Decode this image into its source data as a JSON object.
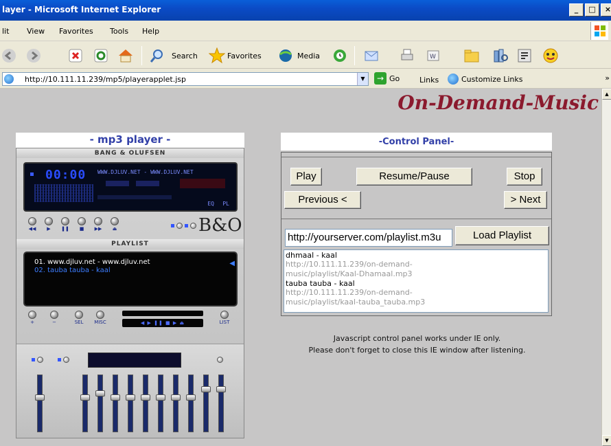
{
  "window": {
    "title": "layer - Microsoft Internet Explorer",
    "min": "_",
    "max": "□",
    "close": "×"
  },
  "menu": {
    "edit": "lit",
    "view": "View",
    "favorites": "Favorites",
    "tools": "Tools",
    "help": "Help"
  },
  "toolbar": {
    "search": "Search",
    "favorites": "Favorites",
    "media": "Media"
  },
  "address": {
    "url": "http://10.111.11.239/mp5/playerapplet.jsp",
    "go": "Go",
    "links": "Links",
    "customize_links": "Customize Links",
    "more": "»"
  },
  "brand": "On-Demand-Music",
  "player": {
    "title": "- mp3 player -",
    "maker": "BANG & OLUFSEN",
    "time": "00:00",
    "marquee": "WWW.DJLUV.NET - WWW.DJLUV.NET",
    "eq_label": "EQ",
    "pl_label": "PL",
    "bo_logo": "B&O",
    "playlist_header": "PLAYLIST",
    "playlist": [
      {
        "text": "01.  www.djluv.net - www.djluv.net",
        "color": "#ffffff"
      },
      {
        "text": "02.  tauba tauba - kaal",
        "color": "#3d7dff"
      }
    ],
    "sel_label": "SEL",
    "misc_label": "MISC",
    "list_label": "LIST",
    "accent": "#3240a8"
  },
  "control_panel": {
    "title": "-Control Panel-",
    "play": "Play",
    "resume_pause": "Resume/Pause",
    "stop": "Stop",
    "previous": "Previous <",
    "next": "> Next",
    "playlist_url": "http://yourserver.com/playlist.m3u",
    "load_playlist": "Load Playlist",
    "songs": [
      {
        "name": "dhmaal - kaal",
        "path1": "http://10.111.11.239/on-demand-",
        "path2": "music/playlist/Kaal-Dhamaal.mp3"
      },
      {
        "name": "tauba tauba - kaal",
        "path1": "http://10.111.11.239/on-demand-",
        "path2": "music/playlist/kaal-tauba_tauba.mp3"
      }
    ]
  },
  "note": {
    "line1": "Javascript control panel works under IE only.",
    "line2": "Please don't forget to close this IE window after listening."
  },
  "colors": {
    "brand": "#8b1a2e",
    "title_bar": "#0b4bc6",
    "page_bg": "#c7c6c6"
  }
}
